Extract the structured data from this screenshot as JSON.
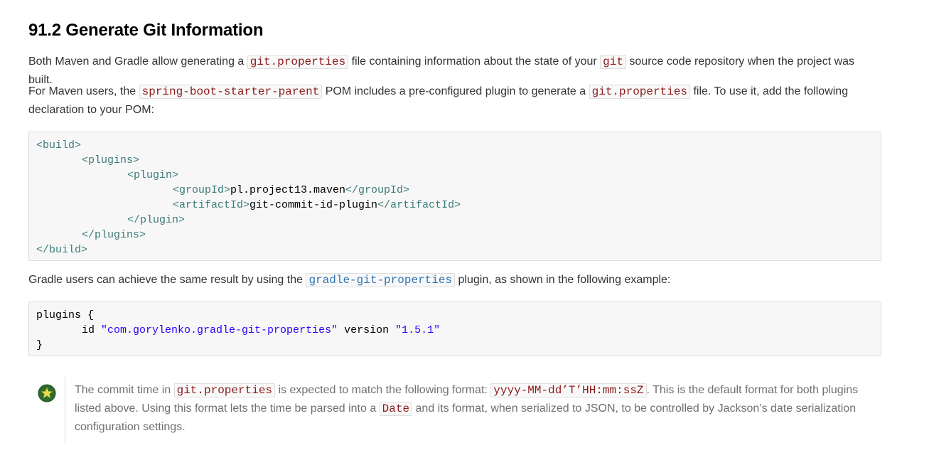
{
  "heading": "91.2 Generate Git Information",
  "p1": {
    "t1": "Both Maven and Gradle allow generating a ",
    "c1": "git.properties",
    "t2": " file containing information about the state of your ",
    "c2": "git",
    "t3": " source code repository when the project was built."
  },
  "p2": {
    "t1": "For Maven users, the ",
    "c1": "spring-boot-starter-parent",
    "t2": " POM includes a pre-configured plugin to generate a ",
    "c2": "git.properties",
    "t3": " file. To use it, add the following declaration to your POM:"
  },
  "maven_code": {
    "l1": "<build>",
    "l2": "<plugins>",
    "l3": "<plugin>",
    "l4_open": "<groupId>",
    "l4_val": "pl.project13.maven",
    "l4_close": "</groupId>",
    "l5_open": "<artifactId>",
    "l5_val": "git-commit-id-plugin",
    "l5_close": "</artifactId>",
    "l6": "</plugin>",
    "l7": "</plugins>",
    "l8": "</build>"
  },
  "p3": {
    "t1": "Gradle users can achieve the same result by using the ",
    "c1": "gradle-git-properties",
    "t2": " plugin, as shown in the following example:"
  },
  "gradle_code": {
    "l1": "plugins {",
    "l2_kw": "id ",
    "l2_str1": "\"com.gorylenko.gradle-git-properties\"",
    "l2_kw2": " version ",
    "l2_str2": "\"1.5.1\"",
    "l3": "}"
  },
  "tip": {
    "icon": "star-tip-icon",
    "t1": "The commit time in ",
    "c1": "git.properties",
    "t2": " is expected to match the following format: ",
    "c2": "yyyy-MM-dd’T’HH:mm:ssZ",
    "t3": ". This is the default format for both plugins listed above. Using this format lets the time be parsed into a ",
    "c3": "Date",
    "t4": " and its format, when serialized to JSON, to be controlled by Jackson’s date serialization configuration settings."
  }
}
